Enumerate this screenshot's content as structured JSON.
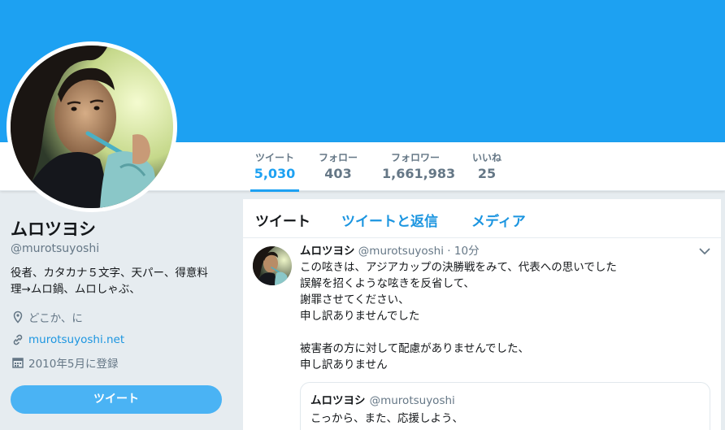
{
  "colors": {
    "accent": "#1da1f2",
    "link": "#1b95e0",
    "muted": "#657786",
    "button": "#4ab3f4"
  },
  "stats": [
    {
      "label": "ツイート",
      "value": "5,030"
    },
    {
      "label": "フォロー",
      "value": "403"
    },
    {
      "label": "フォロワー",
      "value": "1,661,983"
    },
    {
      "label": "いいね",
      "value": "25"
    }
  ],
  "profile": {
    "name": "ムロツヨシ",
    "handle": "@murotsuyoshi",
    "bio_lines": [
      "役者、カタカナ５文字、天パー、得意料",
      "理→ムロ鍋、ムロしゃぶ、"
    ],
    "location": "どこか、に",
    "website": "murotsuyoshi.net",
    "joined": "2010年5月に登録",
    "tweet_button": "ツイート",
    "icons": {
      "location": "location-pin-icon",
      "link": "link-icon",
      "calendar": "calendar-icon"
    }
  },
  "timeline": {
    "tabs": [
      "ツイート",
      "ツイートと返信",
      "メディア"
    ],
    "tweet": {
      "name": "ムロツヨシ",
      "handle": "@murotsuyoshi",
      "separator": "·",
      "time": "10分",
      "lines": [
        "この呟きは、アジアカップの決勝戦をみて、代表への思いでした",
        "誤解を招くような呟きを反省して、",
        "謝罪させてください、",
        "申し訳ありませんでした",
        "",
        "被害者の方に対して配慮がありませんでした、",
        "申し訳ありません"
      ],
      "quote": {
        "name": "ムロツヨシ",
        "handle": "@murotsuyoshi",
        "text": "こっから、また、応援しよう、"
      }
    }
  }
}
